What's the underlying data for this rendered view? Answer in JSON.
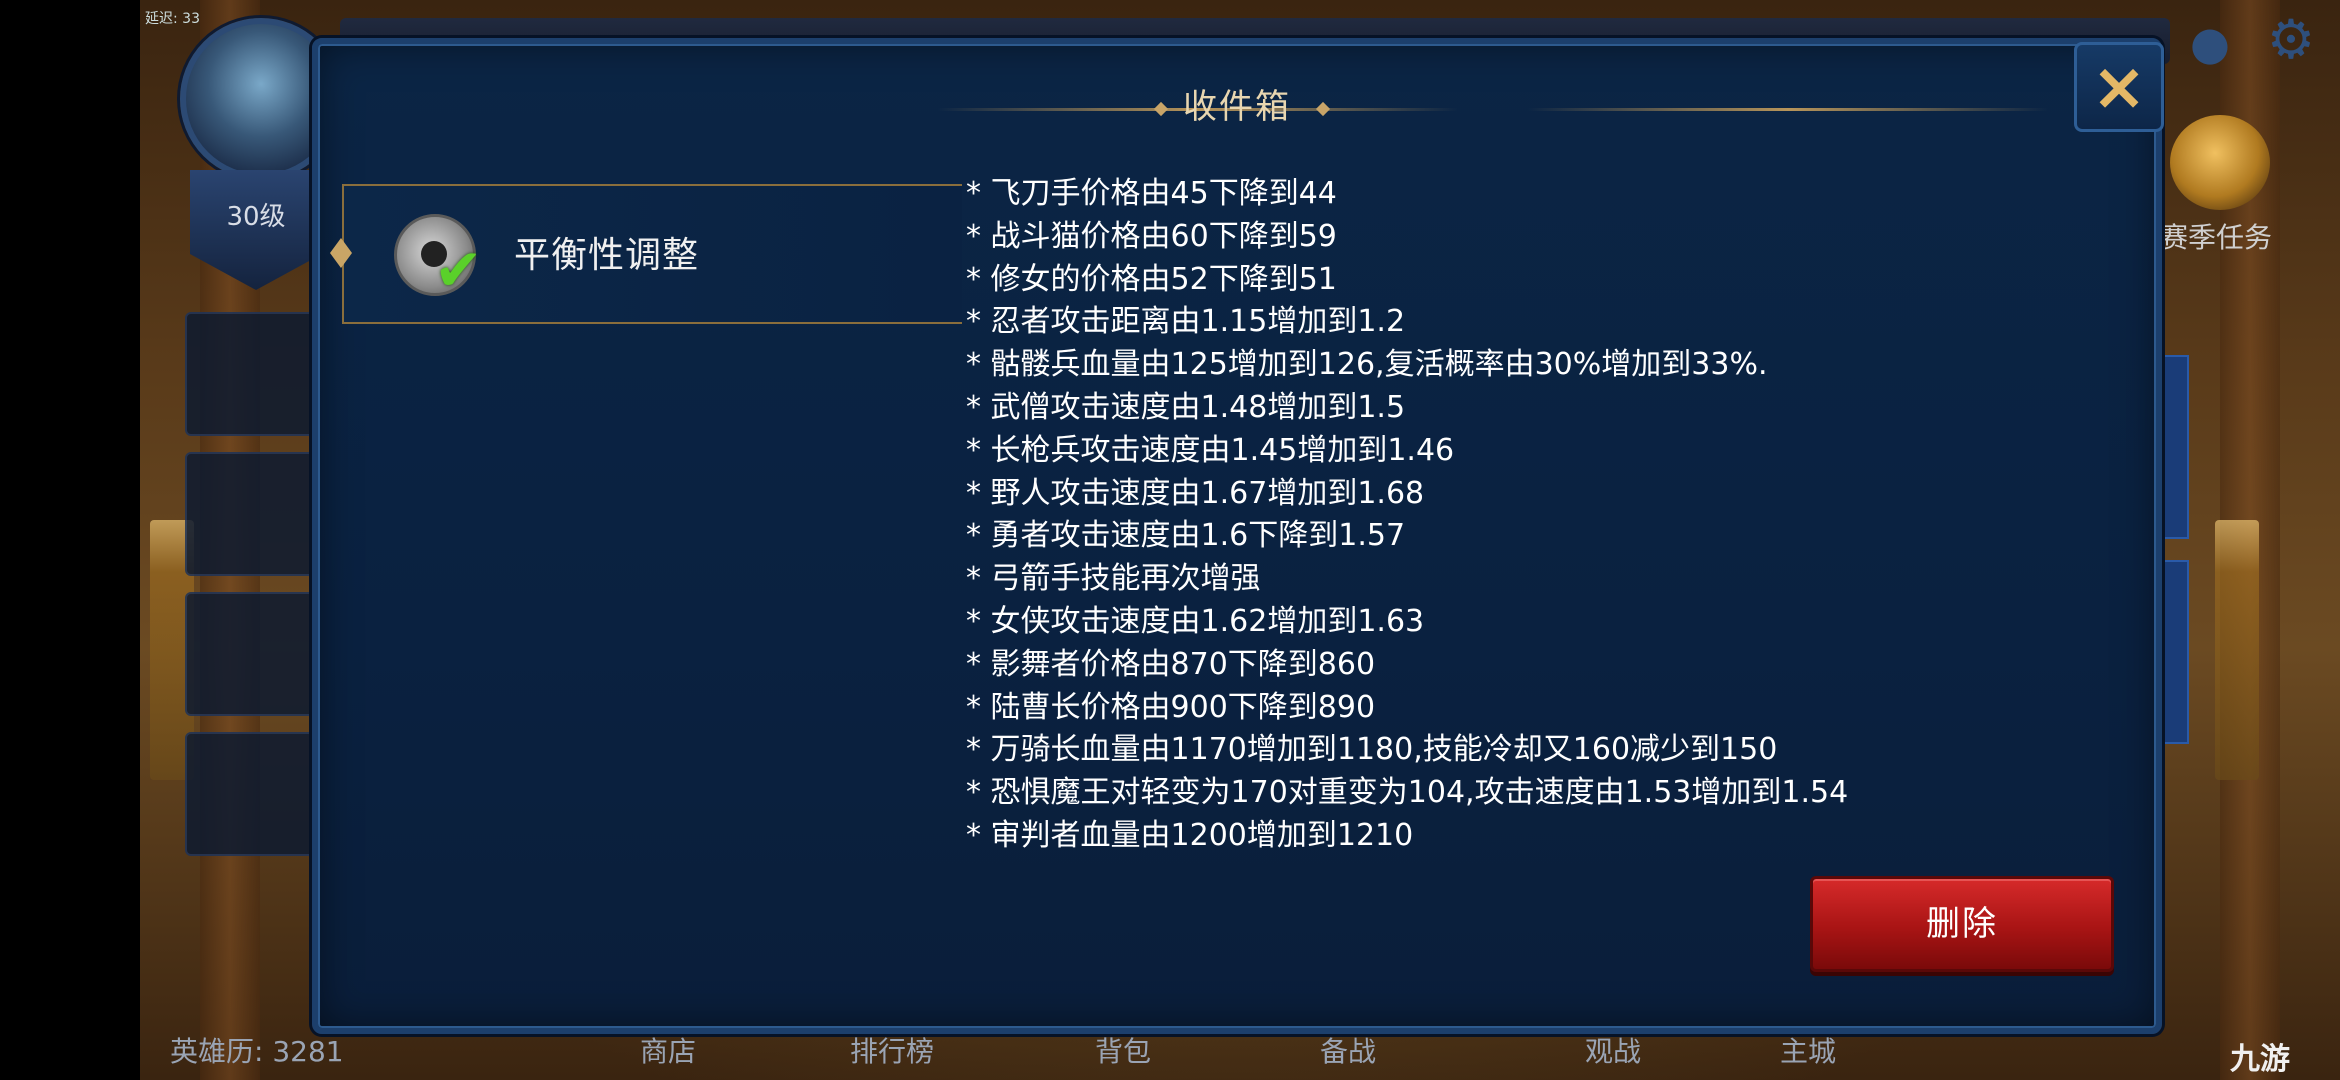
{
  "status_bar": {
    "text": "延迟: 33"
  },
  "player": {
    "level": "30级",
    "hero_history": "英雄历: 3281"
  },
  "top_right": {
    "season_task_label": "赛季任务"
  },
  "bottom_nav": {
    "items": [
      "商店",
      "排行榜",
      "背包",
      "备战",
      "观战",
      "主城"
    ]
  },
  "watermark": {
    "text": "九游"
  },
  "dialog": {
    "title": "收件箱",
    "close_label": "×",
    "message_item": {
      "title": "平衡性调整",
      "icon": "mail-check-icon"
    },
    "content_lines": [
      "* 飞刀手价格由45下降到44",
      "* 战斗猫价格由60下降到59",
      "* 修女的价格由52下降到51",
      "* 忍者攻击距离由1.15增加到1.2",
      "* 骷髅兵血量由125增加到126,复活概率由30%增加到33%.",
      "* 武僧攻击速度由1.48增加到1.5",
      "* 长枪兵攻击速度由1.45增加到1.46",
      "* 野人攻击速度由1.67增加到1.68",
      "* 勇者攻击速度由1.6下降到1.57",
      "* 弓箭手技能再次增强",
      "* 女侠攻击速度由1.62增加到1.63",
      "* 影舞者价格由870下降到860",
      "* 陆曹长价格由900下降到890",
      "* 万骑长血量由1170增加到1180,技能冷却又160减少到150",
      "* 恐惧魔王对轻变为170对重变为104,攻击速度由1.53增加到1.54",
      "* 审判者血量由1200增加到1210"
    ],
    "delete_label": "删除"
  },
  "colors": {
    "accent_gold": "#e4b866",
    "delete_red": "#c41e1e",
    "panel_blue": "#0b2545",
    "check_green": "#5ad02a"
  }
}
